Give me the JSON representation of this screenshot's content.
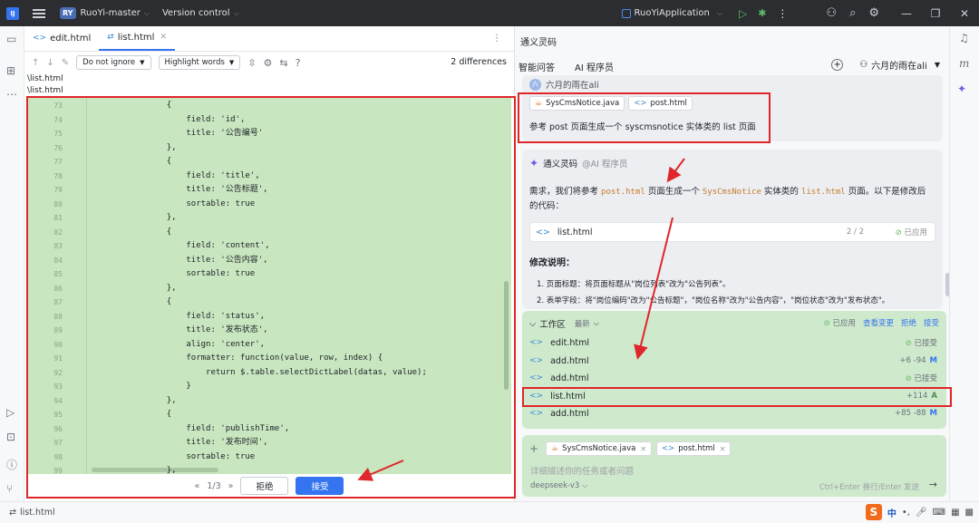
{
  "titlebar": {
    "project_badge": "RY",
    "project_name": "RuoYi-master",
    "vcs": "Version control",
    "run_config": "RuoYiApplication"
  },
  "editor": {
    "tabs": [
      {
        "label": "edit.html",
        "active": false
      },
      {
        "label": "list.html",
        "active": true
      }
    ],
    "toolbar": {
      "ignore": "Do not ignore",
      "highlight": "Highlight words",
      "help": "?",
      "differences": "2 differences"
    },
    "paths": [
      "\\list.html",
      "\\list.html"
    ],
    "lines": [
      {
        "n": "73",
        "t": "                {"
      },
      {
        "n": "74",
        "t": "                    field: 'id',"
      },
      {
        "n": "75",
        "t": "                    title: '公告编号'"
      },
      {
        "n": "76",
        "t": "                },"
      },
      {
        "n": "77",
        "t": "                {"
      },
      {
        "n": "78",
        "t": "                    field: 'title',"
      },
      {
        "n": "79",
        "t": "                    title: '公告标题',"
      },
      {
        "n": "80",
        "t": "                    sortable: true"
      },
      {
        "n": "81",
        "t": "                },"
      },
      {
        "n": "82",
        "t": "                {"
      },
      {
        "n": "83",
        "t": "                    field: 'content',"
      },
      {
        "n": "84",
        "t": "                    title: '公告内容',"
      },
      {
        "n": "85",
        "t": "                    sortable: true"
      },
      {
        "n": "86",
        "t": "                },"
      },
      {
        "n": "87",
        "t": "                {"
      },
      {
        "n": "88",
        "t": "                    field: 'status',"
      },
      {
        "n": "89",
        "t": "                    title: '发布状态',"
      },
      {
        "n": "90",
        "t": "                    align: 'center',"
      },
      {
        "n": "91",
        "t": "                    formatter: function(value, row, index) {"
      },
      {
        "n": "92",
        "t": "                        return $.table.selectDictLabel(datas, value);"
      },
      {
        "n": "93",
        "t": "                    }"
      },
      {
        "n": "94",
        "t": "                },"
      },
      {
        "n": "95",
        "t": "                {"
      },
      {
        "n": "96",
        "t": "                    field: 'publishTime',"
      },
      {
        "n": "97",
        "t": "                    title: '发布时间',"
      },
      {
        "n": "98",
        "t": "                    sortable: true"
      },
      {
        "n": "99",
        "t": "                },"
      }
    ],
    "nav": {
      "prev": "«",
      "counter": "1/3",
      "next": "»",
      "reject": "拒绝",
      "accept": "接受"
    }
  },
  "panel": {
    "title": "通义灵码",
    "tabs": [
      "智能问答",
      "AI 程序员"
    ],
    "user": "六月的雨在ali",
    "user_msg": {
      "name": "六月的雨在ali",
      "avatar": "六",
      "chips": [
        "SysCmsNotice.java",
        "post.html"
      ],
      "text": "参考 post 页面生成一个 syscmsnotice 实体类的 list 页面"
    },
    "ai_msg": {
      "name": "通义灵码",
      "role": "@AI 程序员",
      "text": {
        "p1": "需求，我们将参考 ",
        "c1": "post.html",
        "p2": " 页面生成一个 ",
        "c2": "SysCmsNotice",
        "p3": " 实体类的 ",
        "c3": "list.html",
        "p4": " 页面。以下是修改后的代码："
      },
      "file": "list.html",
      "file_count": "2 / 2",
      "file_status": "已应用",
      "mod_title": "修改说明：",
      "mods": [
        "1. 页面标题：将页面标题从\"岗位列表\"改为\"公告列表\"。",
        "2. 表单字段：将\"岗位编码\"改为\"公告标题\"，\"岗位名称\"改为\"公告内容\"，\"岗位状态\"改为\"发布状态\"。"
      ]
    },
    "workspace": {
      "title": "工作区",
      "filter": "最新",
      "applied": "已应用",
      "view_changes": "查看变更",
      "reject": "拒绝",
      "accept": "接受",
      "files": [
        {
          "name": "edit.html",
          "status": "已接受",
          "type": "accepted"
        },
        {
          "name": "add.html",
          "delta": "+6 -94",
          "letter": "M",
          "type": "diff"
        },
        {
          "name": "add.html",
          "status": "已接受",
          "type": "accepted"
        },
        {
          "name": "list.html",
          "delta": "+114",
          "letter": "A",
          "type": "diff"
        },
        {
          "name": "add.html",
          "delta": "+85 -88",
          "letter": "M",
          "type": "diff"
        }
      ]
    },
    "input": {
      "chips": [
        "SysCmsNotice.java",
        "post.html"
      ],
      "placeholder": "详细描述你的任务或者问题",
      "model": "deepseek-v3",
      "hint": "Ctrl+Enter 换行/Enter 发送"
    }
  },
  "statusbar": {
    "path": "list.html",
    "ime": "中"
  },
  "colors": {
    "accent": "#3574f0",
    "highlight": "#e0262a",
    "diff_bg": "#c8e6c0"
  }
}
